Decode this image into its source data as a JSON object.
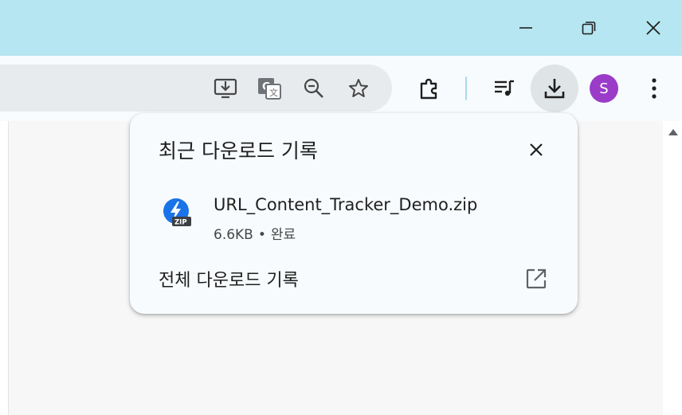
{
  "window": {
    "minimize_icon": "minimize-icon",
    "restore_icon": "restore-icon",
    "close_icon": "close-icon"
  },
  "toolbar": {
    "omnibox_icons": [
      "install-app-icon",
      "translate-icon",
      "zoom-out-icon",
      "bookmark-star-icon"
    ],
    "extension_icon": "puzzle-icon",
    "media_icon": "media-controls-icon",
    "download_icon": "download-icon",
    "profile_initial": "S",
    "menu_icon": "more-vert-icon"
  },
  "downloads_bubble": {
    "title": "최근 다운로드 기록",
    "items": [
      {
        "file_name": "URL_Content_Tracker_Demo.zip",
        "size": "6.6KB",
        "separator": "•",
        "status": "완료",
        "icon": "zip-file-icon"
      }
    ],
    "all_downloads_label": "전체 다운로드 기록"
  },
  "colors": {
    "titlebar": "#b5e6f1",
    "avatar": "#9a3cc8",
    "zip_icon": "#1a73e8"
  }
}
